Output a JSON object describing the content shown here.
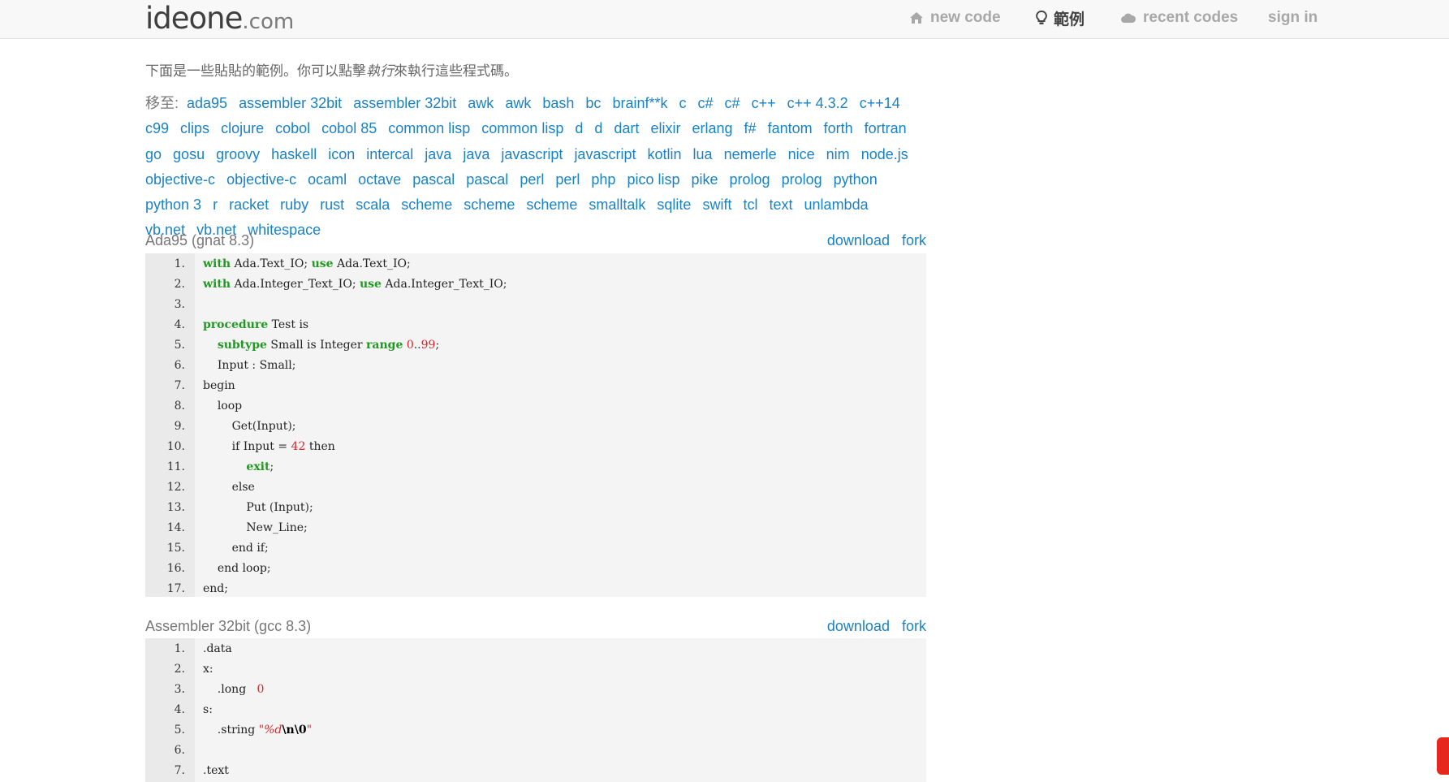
{
  "header": {
    "logo_main": "ideone",
    "logo_tld": ".com",
    "nav": {
      "new_code": "new code",
      "samples": "範例",
      "recent_codes": "recent codes",
      "sign_in": "sign in"
    }
  },
  "intro": {
    "prefix": "下面是一些貼貼的範例。你可以點擊",
    "em": "執行",
    "suffix": "來執行這些程式碼。"
  },
  "goto_label": "移至:",
  "languages": [
    "ada95",
    "assembler 32bit",
    "assembler 32bit",
    "awk",
    "awk",
    "bash",
    "bc",
    "brainf**k",
    "c",
    "c#",
    "c#",
    "c++",
    "c++ 4.3.2",
    "c++14",
    "c99",
    "clips",
    "clojure",
    "cobol",
    "cobol 85",
    "common lisp",
    "common lisp",
    "d",
    "d",
    "dart",
    "elixir",
    "erlang",
    "f#",
    "fantom",
    "forth",
    "fortran",
    "go",
    "gosu",
    "groovy",
    "haskell",
    "icon",
    "intercal",
    "java",
    "java",
    "javascript",
    "javascript",
    "kotlin",
    "lua",
    "nemerle",
    "nice",
    "nim",
    "node.js",
    "objective-c",
    "objective-c",
    "ocaml",
    "octave",
    "pascal",
    "pascal",
    "perl",
    "perl",
    "php",
    "pico lisp",
    "pike",
    "prolog",
    "prolog",
    "python",
    "python 3",
    "r",
    "racket",
    "ruby",
    "rust",
    "scala",
    "scheme",
    "scheme",
    "scheme",
    "smalltalk",
    "sqlite",
    "swift",
    "tcl",
    "text",
    "unlambda",
    "vb.net",
    "vb.net",
    "whitespace"
  ],
  "snippets": [
    {
      "title": "Ada95 (gnat 8.3)",
      "download": "download",
      "fork": "fork",
      "lines": [
        "with Ada.Text_IO; use Ada.Text_IO;",
        "with Ada.Integer_Text_IO; use Ada.Integer_Text_IO;",
        "",
        "procedure Test is",
        "    subtype Small is Integer range 0..99;",
        "    Input : Small;",
        "begin",
        "    loop",
        "        Get(Input);",
        "        if Input = 42 then",
        "            exit;",
        "        else",
        "            Put (Input);",
        "            New_Line;",
        "        end if;",
        "    end loop;",
        "end;"
      ]
    },
    {
      "title": "Assembler 32bit (gcc 8.3)",
      "download": "download",
      "fork": "fork",
      "lines": [
        ".data",
        "x:",
        "    .long   0",
        "s:",
        "    .string \"%d\\n\\0\"",
        "",
        ".text"
      ]
    }
  ],
  "colors": {
    "link": "#1a82c7",
    "keyword": "#229922",
    "number": "#d4252c",
    "code_bg": "#f4f4f4"
  }
}
